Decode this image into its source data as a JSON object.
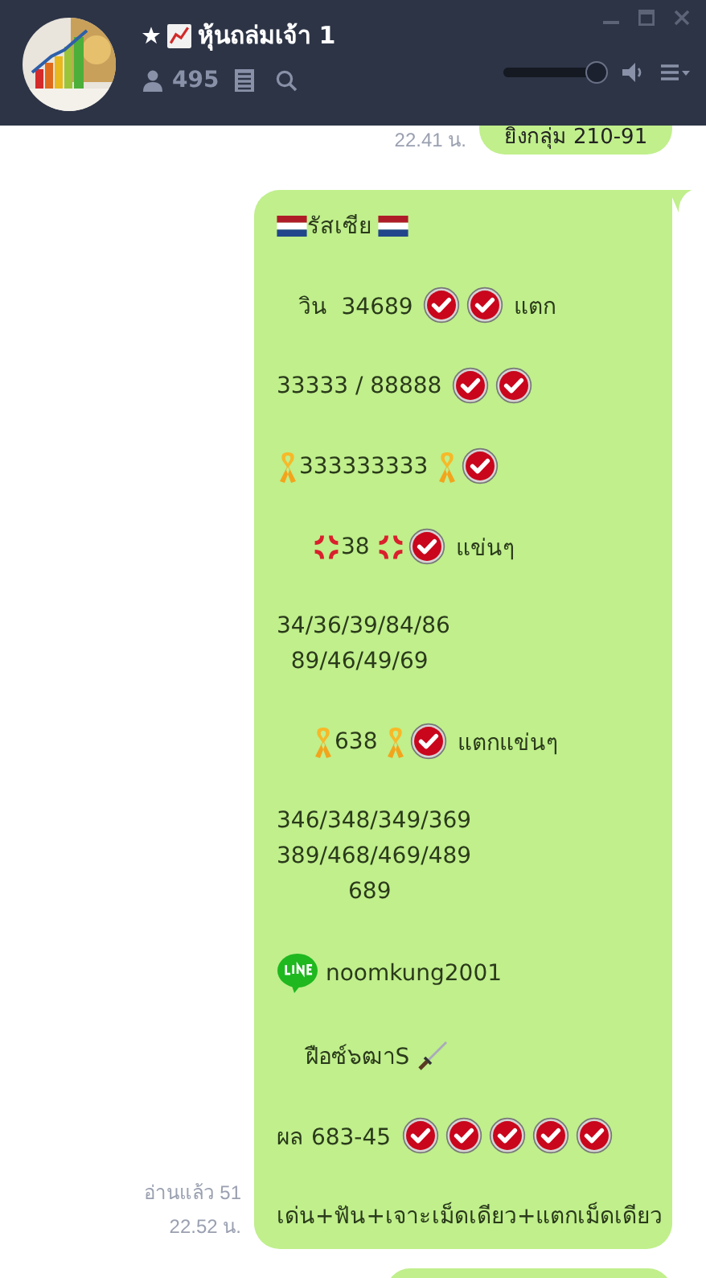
{
  "header": {
    "title": "หุ้นถล่มเจ้า 1",
    "member_count": "495"
  },
  "volume": {
    "level": 0.9
  },
  "earlier": {
    "time": "22.41 น.",
    "text": "ยิงกลุ่ม 210-91"
  },
  "message": {
    "read": "อ่านแล้ว 51",
    "time": "22.52 น.",
    "paragraphs": [
      [
        [
          {
            "kind": "flag"
          },
          {
            "kind": "text",
            "text": "รัสเซีย "
          },
          {
            "kind": "flag"
          }
        ]
      ],
      [
        [
          {
            "kind": "text",
            "text": "   วิน  34689 "
          },
          {
            "kind": "check"
          },
          {
            "kind": "check"
          },
          {
            "kind": "text",
            "text": " แตก"
          }
        ]
      ],
      [
        [
          {
            "kind": "text",
            "text": "33333 / 88888 "
          },
          {
            "kind": "check"
          },
          {
            "kind": "check"
          }
        ]
      ],
      [
        [
          {
            "kind": "ribbon"
          },
          {
            "kind": "text",
            "text": "333333333 "
          },
          {
            "kind": "ribbon"
          },
          {
            "kind": "check"
          }
        ]
      ],
      [
        [
          {
            "kind": "indent"
          },
          {
            "kind": "anger"
          },
          {
            "kind": "text",
            "text": "38 "
          },
          {
            "kind": "anger"
          },
          {
            "kind": "check"
          },
          {
            "kind": "text",
            "text": " แข่นๆ"
          }
        ]
      ],
      [
        [
          {
            "kind": "text",
            "text": "34/36/39/84/86"
          }
        ],
        [
          {
            "kind": "text",
            "text": "  89/46/49/69"
          }
        ]
      ],
      [
        [
          {
            "kind": "indent"
          },
          {
            "kind": "ribbon"
          },
          {
            "kind": "text",
            "text": "638 "
          },
          {
            "kind": "ribbon"
          },
          {
            "kind": "check"
          },
          {
            "kind": "text",
            "text": " แตกแข่นๆ"
          }
        ]
      ],
      [
        [
          {
            "kind": "text",
            "text": "346/348/349/369"
          }
        ],
        [
          {
            "kind": "text",
            "text": "389/468/469/489"
          }
        ],
        [
          {
            "kind": "text",
            "text": "          689"
          }
        ]
      ],
      [
        [
          {
            "kind": "line-logo"
          },
          {
            "kind": "text",
            "text": " noomkung2001"
          }
        ]
      ],
      [
        [
          {
            "kind": "text",
            "text": "    ฝือซ์๖ฒาS "
          },
          {
            "kind": "dagger"
          }
        ]
      ],
      [
        [
          {
            "kind": "text",
            "text": "ผล 683-45 "
          },
          {
            "kind": "check"
          },
          {
            "kind": "check"
          },
          {
            "kind": "check"
          },
          {
            "kind": "check"
          },
          {
            "kind": "check"
          }
        ]
      ],
      [
        [
          {
            "kind": "text",
            "text": "เด่น+ฟัน+เจาะเม็ดเดียว+แตกเม็ดเดียว"
          }
        ]
      ]
    ]
  }
}
